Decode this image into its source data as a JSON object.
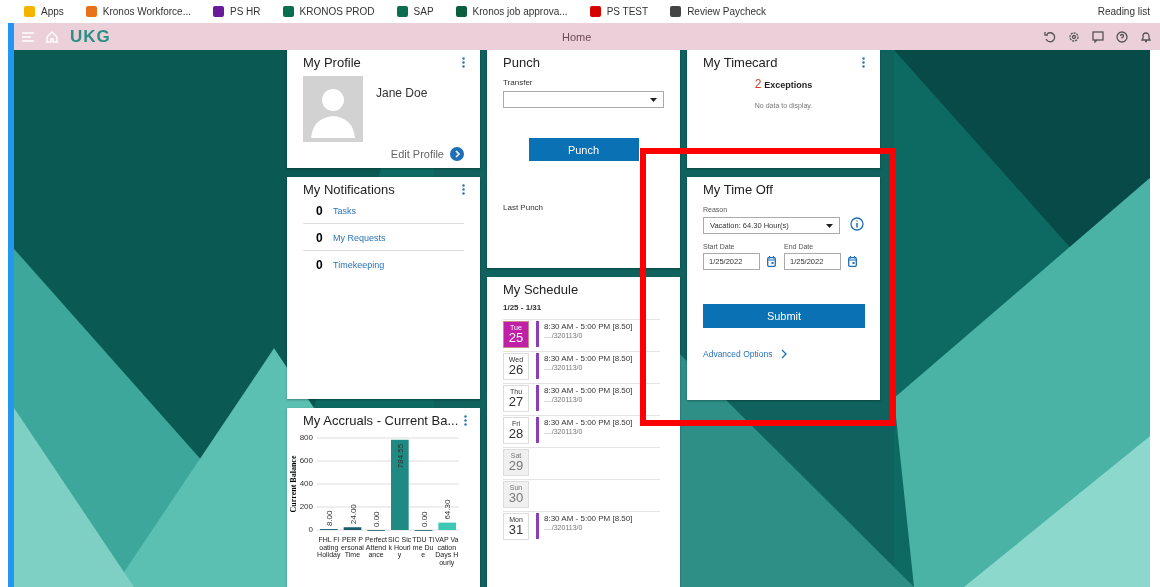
{
  "bookmarks": [
    {
      "label": "Apps",
      "color": "#f4b400"
    },
    {
      "label": "Kronos Workforce...",
      "color": "#e8711a"
    },
    {
      "label": "PS HR",
      "color": "#6a1b9a"
    },
    {
      "label": "KRONOS PROD",
      "color": "#0b6e4f"
    },
    {
      "label": "SAP",
      "color": "#0b6e4f"
    },
    {
      "label": "Kronos job approva...",
      "color": "#0b5e3e"
    },
    {
      "label": "PS TEST",
      "color": "#d50000"
    },
    {
      "label": "Review Paycheck",
      "color": "#444444"
    }
  ],
  "reading_list": "Reading list",
  "header": {
    "logo": "UKG",
    "title": "Home"
  },
  "profile": {
    "title": "My Profile",
    "name": "Jane Doe",
    "link": "Edit Profile"
  },
  "notifications": {
    "title": "My Notifications",
    "items": [
      {
        "count": "0",
        "label": "Tasks"
      },
      {
        "count": "0",
        "label": "My Requests"
      },
      {
        "count": "0",
        "label": "Timekeeping"
      }
    ]
  },
  "accruals": {
    "title": "My Accruals - Current Ba...",
    "chart_data": {
      "type": "bar",
      "ylabel": "Current Balance",
      "categories": [
        "FHL Floating Holiday",
        "PER Personal Time",
        "Perfect Attendance",
        "SIC Sick Hourly",
        "TDU Time Due",
        "VAP Vacation Days Hourly"
      ],
      "series": [
        {
          "color": "#1a5e6e",
          "values": [
            8,
            24,
            0,
            null,
            0,
            null
          ],
          "value_labels": [
            "8.00",
            "24.00",
            "0.00",
            null,
            "0.00",
            null
          ]
        },
        {
          "color": "#1f8a84",
          "values": [
            null,
            null,
            null,
            784.55,
            null,
            null
          ],
          "value_labels": [
            null,
            null,
            null,
            "784.55",
            null,
            null
          ]
        },
        {
          "color": "#3cc8b4",
          "values": [
            null,
            null,
            null,
            null,
            null,
            64.3
          ],
          "value_labels": [
            null,
            null,
            null,
            null,
            null,
            "64.30"
          ]
        }
      ],
      "grid": true,
      "ylim": [
        0,
        800
      ],
      "yticks": [
        {
          "value": 0,
          "label": "0"
        },
        {
          "value": 200,
          "label": "200"
        },
        {
          "value": 400,
          "label": "400"
        },
        {
          "value": 600,
          "label": "600"
        },
        {
          "value": 800,
          "label": "800"
        }
      ],
      "data_labels": "value_labels"
    }
  },
  "punch": {
    "title": "Punch",
    "transfer_label": "Transfer",
    "button": "Punch",
    "last_punch": "Last Punch"
  },
  "schedule": {
    "title": "My Schedule",
    "range": "1/25 - 1/31",
    "days": [
      {
        "weekday": "Tue",
        "date": "25",
        "selected": true,
        "weekend": false,
        "shift": "8:30 AM - 5:00 PM [8.50]",
        "code": "..../320113/0"
      },
      {
        "weekday": "Wed",
        "date": "26",
        "selected": false,
        "weekend": false,
        "shift": "8:30 AM - 5:00 PM [8.50]",
        "code": "..../320113/0"
      },
      {
        "weekday": "Thu",
        "date": "27",
        "selected": false,
        "weekend": false,
        "shift": "8:30 AM - 5:00 PM [8.50]",
        "code": "..../320113/0"
      },
      {
        "weekday": "Fri",
        "date": "28",
        "selected": false,
        "weekend": false,
        "shift": "8:30 AM - 5:00 PM [8.50]",
        "code": "..../320113/0"
      },
      {
        "weekday": "Sat",
        "date": "29",
        "selected": false,
        "weekend": true
      },
      {
        "weekday": "Sun",
        "date": "30",
        "selected": false,
        "weekend": true
      },
      {
        "weekday": "Mon",
        "date": "31",
        "selected": false,
        "weekend": false,
        "shift": "8:30 AM - 5:00 PM [8.50]",
        "code": "..../320113/0"
      }
    ]
  },
  "timecard": {
    "title": "My Timecard",
    "exceptions_count": "2",
    "exceptions_label": "Exceptions",
    "empty": "No data to display."
  },
  "time_off": {
    "title": "My Time Off",
    "reason_label": "Reason",
    "reason": "Vacation: 64.30 Hour(s)",
    "start_label": "Start Date",
    "start": "1/25/2022",
    "end_label": "End Date",
    "end": "1/25/2022",
    "button": "Submit",
    "link": "Advanced Options"
  }
}
